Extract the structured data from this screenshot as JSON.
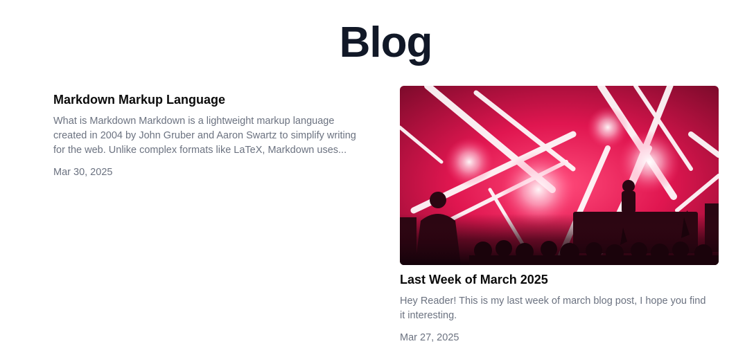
{
  "page": {
    "title": "Blog"
  },
  "posts": [
    {
      "title": "Markdown Markup Language",
      "excerpt_lines": [
        "What is Markdown Markdown is a lightweight markup language",
        "created in 2004 by John Gruber and Aaron Swartz to simplify writing",
        "for the web. Unlike complex formats like LaTeX, Markdown uses..."
      ],
      "date": "Mar 30, 2025"
    },
    {
      "title": "Last Week of March 2025",
      "excerpt_lines": [
        "Hey Reader! This is my last week of march blog post, I hope you find",
        "it interesting."
      ],
      "date": "Mar 27, 2025",
      "image": "concert-stage-lights"
    }
  ]
}
